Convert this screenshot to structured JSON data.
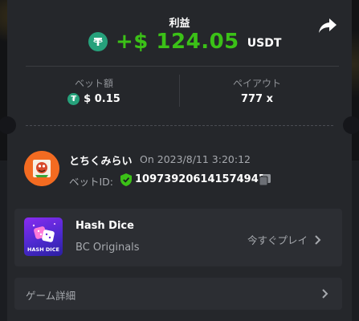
{
  "header": {
    "title": "利益",
    "profit_amount": "+$ 124.05",
    "profit_currency": "USDT",
    "share_icon": "share-icon"
  },
  "stats": {
    "bet_amount_label": "ベット額",
    "bet_amount_value": "$ 0.15",
    "payout_label": "ペイアウト",
    "payout_value": "777 x"
  },
  "bet": {
    "user_name": "とちくみらい",
    "time_text": "On 2023/8/11 3:20:12",
    "bet_id_label": "ベットID:",
    "bet_id": "109739206141574945"
  },
  "game": {
    "name": "Hash Dice",
    "provider": "BC Originals",
    "play_label": "今すぐプレイ",
    "thumb_text": "HASH DICE"
  },
  "details": {
    "label": "ゲーム詳細"
  },
  "colors": {
    "profit": "#3bc117",
    "usdt": "#26a17b",
    "card": "#25272b",
    "panel": "#2c2e33"
  }
}
